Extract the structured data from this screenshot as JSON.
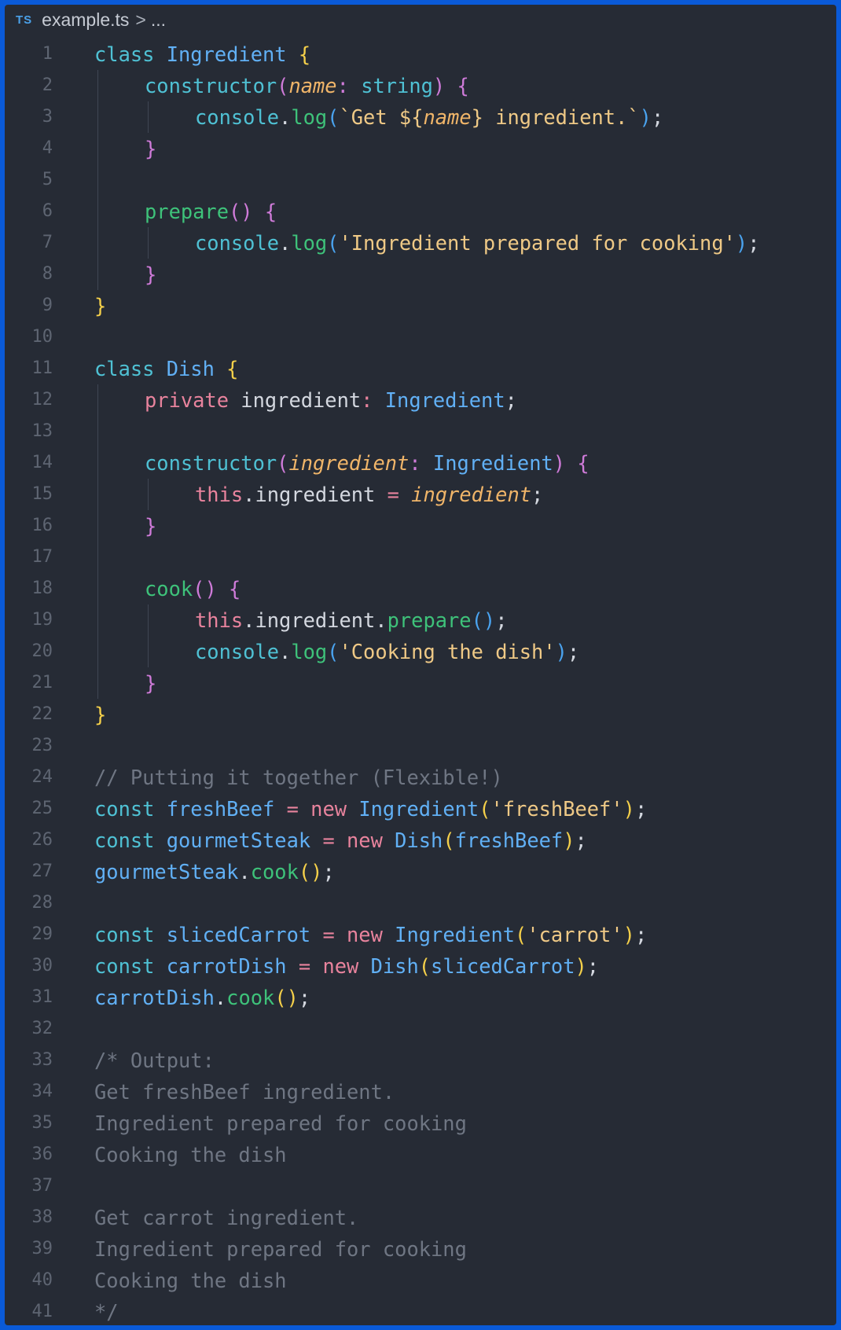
{
  "breadcrumb": {
    "lang_badge": "TS",
    "file": "example.ts",
    "sep": ">",
    "more": "..."
  },
  "colors": {
    "background": "#262b35",
    "frame": "#0a5ad8",
    "keyword": "#4fc1d4",
    "type": "#61b0f5",
    "function": "#3ec27a",
    "string": "#efc986",
    "comment": "#6f7683"
  },
  "lines": [
    {
      "n": "1",
      "indent": 0,
      "tokens": [
        [
          "k",
          "class "
        ],
        [
          "t",
          "Ingredient "
        ],
        [
          "y",
          "{"
        ]
      ]
    },
    {
      "n": "2",
      "indent": 1,
      "tokens": [
        [
          "k",
          "constructor"
        ],
        [
          "pn",
          "("
        ],
        [
          "pi",
          "name"
        ],
        [
          "pn",
          ": "
        ],
        [
          "k",
          "string"
        ],
        [
          "pn",
          ") {"
        ]
      ]
    },
    {
      "n": "3",
      "indent": 2,
      "tokens": [
        [
          "k",
          "console"
        ],
        [
          "m",
          "."
        ],
        [
          "f",
          "log"
        ],
        [
          "b",
          "("
        ],
        [
          "s",
          "`Get "
        ],
        [
          "s",
          "${"
        ],
        [
          "pi",
          "name"
        ],
        [
          "s",
          "} ingredient.`"
        ],
        [
          "b",
          ")"
        ],
        [
          "m",
          ";"
        ]
      ]
    },
    {
      "n": "4",
      "indent": 1,
      "guides": 1,
      "tokens": [
        [
          "pn",
          "}"
        ]
      ]
    },
    {
      "n": "5",
      "indent": 0,
      "guides": 1,
      "tokens": []
    },
    {
      "n": "6",
      "indent": 1,
      "tokens": [
        [
          "f",
          "prepare"
        ],
        [
          "pn",
          "() {"
        ]
      ]
    },
    {
      "n": "7",
      "indent": 2,
      "tokens": [
        [
          "k",
          "console"
        ],
        [
          "m",
          "."
        ],
        [
          "f",
          "log"
        ],
        [
          "b",
          "("
        ],
        [
          "s",
          "'Ingredient prepared for cooking'"
        ],
        [
          "b",
          ")"
        ],
        [
          "m",
          ";"
        ]
      ]
    },
    {
      "n": "8",
      "indent": 1,
      "guides": 1,
      "tokens": [
        [
          "pn",
          "}"
        ]
      ]
    },
    {
      "n": "9",
      "indent": 0,
      "tokens": [
        [
          "y",
          "}"
        ]
      ]
    },
    {
      "n": "10",
      "indent": 0,
      "tokens": []
    },
    {
      "n": "11",
      "indent": 0,
      "tokens": [
        [
          "k",
          "class "
        ],
        [
          "t",
          "Dish "
        ],
        [
          "y",
          "{"
        ]
      ]
    },
    {
      "n": "12",
      "indent": 1,
      "tokens": [
        [
          "p",
          "private "
        ],
        [
          "m",
          "ingredient"
        ],
        [
          "p",
          ": "
        ],
        [
          "t",
          "Ingredient"
        ],
        [
          "m",
          ";"
        ]
      ]
    },
    {
      "n": "13",
      "indent": 0,
      "guides": 1,
      "tokens": []
    },
    {
      "n": "14",
      "indent": 1,
      "tokens": [
        [
          "k",
          "constructor"
        ],
        [
          "pn",
          "("
        ],
        [
          "pi",
          "ingredient"
        ],
        [
          "pn",
          ": "
        ],
        [
          "t",
          "Ingredient"
        ],
        [
          "pn",
          ") {"
        ]
      ]
    },
    {
      "n": "15",
      "indent": 2,
      "tokens": [
        [
          "p",
          "this"
        ],
        [
          "m",
          ".ingredient "
        ],
        [
          "p",
          "= "
        ],
        [
          "pi",
          "ingredient"
        ],
        [
          "m",
          ";"
        ]
      ]
    },
    {
      "n": "16",
      "indent": 1,
      "guides": 1,
      "tokens": [
        [
          "pn",
          "}"
        ]
      ]
    },
    {
      "n": "17",
      "indent": 0,
      "guides": 1,
      "tokens": []
    },
    {
      "n": "18",
      "indent": 1,
      "tokens": [
        [
          "f",
          "cook"
        ],
        [
          "pn",
          "() {"
        ]
      ]
    },
    {
      "n": "19",
      "indent": 2,
      "tokens": [
        [
          "p",
          "this"
        ],
        [
          "m",
          ".ingredient."
        ],
        [
          "f",
          "prepare"
        ],
        [
          "b",
          "()"
        ],
        [
          "m",
          ";"
        ]
      ]
    },
    {
      "n": "20",
      "indent": 2,
      "tokens": [
        [
          "k",
          "console"
        ],
        [
          "m",
          "."
        ],
        [
          "f",
          "log"
        ],
        [
          "b",
          "("
        ],
        [
          "s",
          "'Cooking the dish'"
        ],
        [
          "b",
          ")"
        ],
        [
          "m",
          ";"
        ]
      ]
    },
    {
      "n": "21",
      "indent": 1,
      "guides": 1,
      "tokens": [
        [
          "pn",
          "}"
        ]
      ]
    },
    {
      "n": "22",
      "indent": 0,
      "tokens": [
        [
          "y",
          "}"
        ]
      ]
    },
    {
      "n": "23",
      "indent": 0,
      "tokens": []
    },
    {
      "n": "24",
      "indent": 0,
      "tokens": [
        [
          "c",
          "// Putting it together (Flexible!)"
        ]
      ]
    },
    {
      "n": "25",
      "indent": 0,
      "tokens": [
        [
          "k",
          "const "
        ],
        [
          "t",
          "freshBeef "
        ],
        [
          "p",
          "= new "
        ],
        [
          "t",
          "Ingredient"
        ],
        [
          "y",
          "("
        ],
        [
          "s",
          "'freshBeef'"
        ],
        [
          "y",
          ")"
        ],
        [
          "m",
          ";"
        ]
      ]
    },
    {
      "n": "26",
      "indent": 0,
      "tokens": [
        [
          "k",
          "const "
        ],
        [
          "t",
          "gourmetSteak "
        ],
        [
          "p",
          "= new "
        ],
        [
          "t",
          "Dish"
        ],
        [
          "y",
          "("
        ],
        [
          "t",
          "freshBeef"
        ],
        [
          "y",
          ")"
        ],
        [
          "m",
          ";"
        ]
      ]
    },
    {
      "n": "27",
      "indent": 0,
      "tokens": [
        [
          "t",
          "gourmetSteak"
        ],
        [
          "m",
          "."
        ],
        [
          "f",
          "cook"
        ],
        [
          "y",
          "()"
        ],
        [
          "m",
          ";"
        ]
      ]
    },
    {
      "n": "28",
      "indent": 0,
      "tokens": []
    },
    {
      "n": "29",
      "indent": 0,
      "tokens": [
        [
          "k",
          "const "
        ],
        [
          "t",
          "slicedCarrot "
        ],
        [
          "p",
          "= new "
        ],
        [
          "t",
          "Ingredient"
        ],
        [
          "y",
          "("
        ],
        [
          "s",
          "'carrot'"
        ],
        [
          "y",
          ")"
        ],
        [
          "m",
          ";"
        ]
      ]
    },
    {
      "n": "30",
      "indent": 0,
      "tokens": [
        [
          "k",
          "const "
        ],
        [
          "t",
          "carrotDish "
        ],
        [
          "p",
          "= new "
        ],
        [
          "t",
          "Dish"
        ],
        [
          "y",
          "("
        ],
        [
          "t",
          "slicedCarrot"
        ],
        [
          "y",
          ")"
        ],
        [
          "m",
          ";"
        ]
      ]
    },
    {
      "n": "31",
      "indent": 0,
      "tokens": [
        [
          "t",
          "carrotDish"
        ],
        [
          "m",
          "."
        ],
        [
          "f",
          "cook"
        ],
        [
          "y",
          "()"
        ],
        [
          "m",
          ";"
        ]
      ]
    },
    {
      "n": "32",
      "indent": 0,
      "tokens": []
    },
    {
      "n": "33",
      "indent": 0,
      "tokens": [
        [
          "c",
          "/* Output:"
        ]
      ]
    },
    {
      "n": "34",
      "indent": 0,
      "tokens": [
        [
          "c",
          "Get freshBeef ingredient."
        ]
      ]
    },
    {
      "n": "35",
      "indent": 0,
      "tokens": [
        [
          "c",
          "Ingredient prepared for cooking"
        ]
      ]
    },
    {
      "n": "36",
      "indent": 0,
      "tokens": [
        [
          "c",
          "Cooking the dish"
        ]
      ]
    },
    {
      "n": "37",
      "indent": 0,
      "tokens": []
    },
    {
      "n": "38",
      "indent": 0,
      "tokens": [
        [
          "c",
          "Get carrot ingredient."
        ]
      ]
    },
    {
      "n": "39",
      "indent": 0,
      "tokens": [
        [
          "c",
          "Ingredient prepared for cooking"
        ]
      ]
    },
    {
      "n": "40",
      "indent": 0,
      "tokens": [
        [
          "c",
          "Cooking the dish"
        ]
      ]
    },
    {
      "n": "41",
      "indent": 0,
      "tokens": [
        [
          "c",
          "*/"
        ]
      ]
    }
  ]
}
